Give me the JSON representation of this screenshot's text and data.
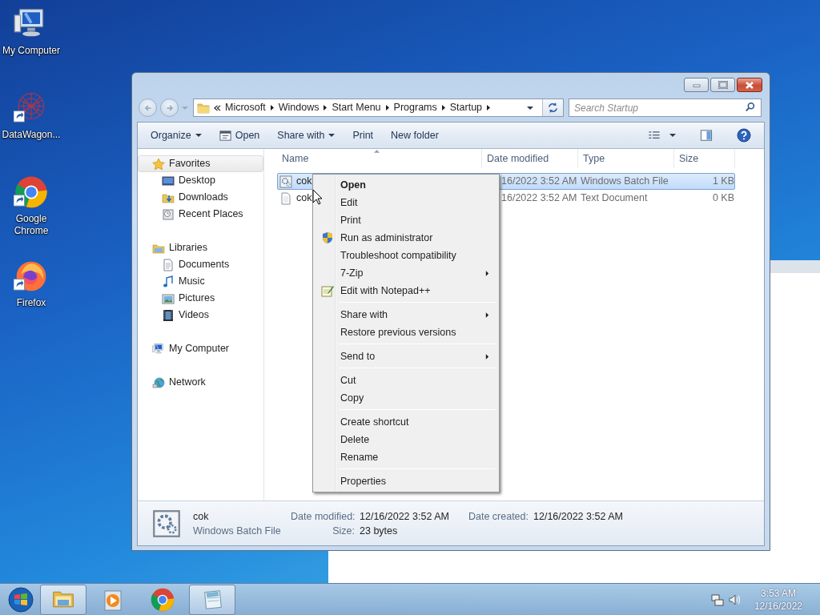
{
  "desktop_icons": [
    {
      "label": "My Computer",
      "kind": "computer",
      "shortcut": false
    },
    {
      "label": "DataWagon...",
      "kind": "datawagon",
      "shortcut": true
    },
    {
      "label": "Google Chrome",
      "kind": "chrome",
      "shortcut": true
    },
    {
      "label": "Firefox",
      "kind": "firefox",
      "shortcut": true
    }
  ],
  "window": {
    "nav_buttons": [
      {
        "kind": "back",
        "disabled": true
      },
      {
        "kind": "forward",
        "disabled": true
      }
    ],
    "breadcrumb": [
      "Microsoft",
      "Windows",
      "Start Menu",
      "Programs",
      "Startup"
    ],
    "search": {
      "placeholder": "Search Startup"
    },
    "toolbar": [
      {
        "label": "Organize",
        "dropdown": true
      },
      {
        "label": "Open",
        "dropdown": false,
        "kind": "open"
      },
      {
        "label": "Share with",
        "dropdown": true
      },
      {
        "label": "Print",
        "dropdown": false
      },
      {
        "label": "New folder",
        "dropdown": false
      }
    ],
    "toolbar_icons": [
      {
        "kind": "views",
        "dropdown": true
      },
      {
        "kind": "preview",
        "dropdown": false
      },
      {
        "kind": "help",
        "dropdown": false
      }
    ],
    "nav_pane": [
      {
        "label": "Favorites",
        "kind": "star",
        "selected": true,
        "children": [
          {
            "label": "Desktop",
            "kind": "desktop",
            "selected": false
          },
          {
            "label": "Downloads",
            "kind": "downloads",
            "selected": false
          },
          {
            "label": "Recent Places",
            "kind": "recent",
            "selected": false
          }
        ]
      },
      {
        "label": "Libraries",
        "kind": "libraries",
        "selected": false,
        "children": [
          {
            "label": "Documents",
            "kind": "documents",
            "selected": false
          },
          {
            "label": "Music",
            "kind": "music",
            "selected": false
          },
          {
            "label": "Pictures",
            "kind": "pictures",
            "selected": false
          },
          {
            "label": "Videos",
            "kind": "videos",
            "selected": false
          }
        ]
      },
      {
        "label": "My Computer",
        "kind": "computer",
        "selected": false
      },
      {
        "label": "Network",
        "kind": "network",
        "selected": false
      }
    ],
    "columns": [
      "Name",
      "Date modified",
      "Type",
      "Size"
    ],
    "files": [
      {
        "name": "cok",
        "kind": "batch",
        "date": "16/2022 3:52 AM",
        "type": "Windows Batch File",
        "size": "1 KB",
        "selected": true
      },
      {
        "name": "cok",
        "kind": "text",
        "date": "16/2022 3:52 AM",
        "type": "Text Document",
        "size": "0 KB",
        "selected": false
      }
    ],
    "details": {
      "name": "cok",
      "type": "Windows Batch File",
      "fields": [
        {
          "label": "Date modified:",
          "value": "12/16/2022 3:52 AM"
        },
        {
          "label": "Size:",
          "value": "23 bytes"
        },
        {
          "label": "Date created:",
          "value": "12/16/2022 3:52 AM"
        }
      ]
    }
  },
  "context_menu": [
    [
      {
        "label": "Open",
        "default": true,
        "submenu": false
      },
      {
        "label": "Edit",
        "default": false,
        "submenu": false
      },
      {
        "label": "Print",
        "default": false,
        "submenu": false
      },
      {
        "label": "Run as administrator",
        "default": false,
        "submenu": false,
        "kind": "shield"
      },
      {
        "label": "Troubleshoot compatibility",
        "default": false,
        "submenu": false
      },
      {
        "label": "7-Zip",
        "default": false,
        "submenu": true
      },
      {
        "label": "Edit with Notepad++",
        "default": false,
        "submenu": false,
        "kind": "notepad"
      }
    ],
    [
      {
        "label": "Share with",
        "default": false,
        "submenu": true
      },
      {
        "label": "Restore previous versions",
        "default": false,
        "submenu": false
      }
    ],
    [
      {
        "label": "Send to",
        "default": false,
        "submenu": true
      }
    ],
    [
      {
        "label": "Cut",
        "default": false,
        "submenu": false
      },
      {
        "label": "Copy",
        "default": false,
        "submenu": false
      }
    ],
    [
      {
        "label": "Create shortcut",
        "default": false,
        "submenu": false
      },
      {
        "label": "Delete",
        "default": false,
        "submenu": false
      },
      {
        "label": "Rename",
        "default": false,
        "submenu": false
      }
    ],
    [
      {
        "label": "Properties",
        "default": false,
        "submenu": false
      }
    ]
  ],
  "taskbar": {
    "items": [
      {
        "kind": "explorer",
        "open": true
      },
      {
        "kind": "mediaplayer",
        "open": false
      },
      {
        "kind": "chrome",
        "open": false
      },
      {
        "kind": "notepad",
        "open": true
      }
    ],
    "clock": {
      "time": "3:53 AM",
      "date": "12/16/2022"
    }
  }
}
